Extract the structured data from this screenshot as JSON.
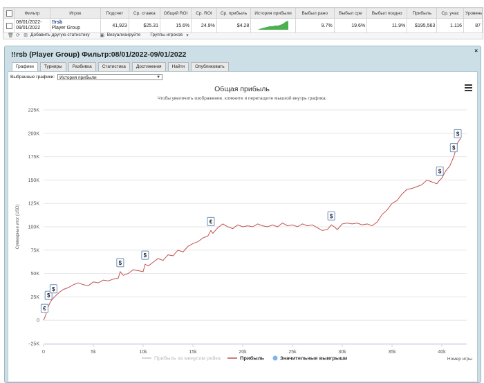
{
  "stats_table": {
    "headers": [
      "Фильтр",
      "Игрок",
      "Подсчет",
      "Ср. ставка",
      "Общий ROI",
      "Ср. ROI",
      "Ср. прибыль",
      "История прибыли",
      "Выбыл рано",
      "Выбыл сре",
      "Выбыл поздно",
      "Прибыль",
      "Ср. учас",
      "Уровень"
    ],
    "row": {
      "filter_line1": "08/01/2022-",
      "filter_line2": "09/01/2022",
      "player_name": "!!rsb",
      "player_group": "Player Group",
      "count": "41,923",
      "avg_stake": "$25.31",
      "total_roi": "15.6%",
      "avg_roi": "24.9%",
      "avg_profit": "$4.28",
      "early": "9.7%",
      "middle": "19.6%",
      "late": "11.9%",
      "profit": "$195,563",
      "avg_entrants": "1.116",
      "level": "87"
    }
  },
  "toolbar": {
    "add_stats": "Добавить другую статистику",
    "visualize": "Визуализируйте",
    "player_groups": "Группы игроков"
  },
  "panel": {
    "title": "!!rsb (Player Group) Фильтр:08/01/2022-09/01/2022",
    "close": "×",
    "tabs": [
      "Графики",
      "Турниры",
      "Разбивка",
      "Статистика",
      "Достижения",
      "Найти",
      "Опубликовать"
    ],
    "selected_charts_label": "Выбранные графики:",
    "selected_chart_value": "История прибыли"
  },
  "colors": {
    "profit_line": "#c0504d",
    "rake_line": "#c7c7c7",
    "win_marker": "#7cb5ec",
    "sparkline": "#4caf50",
    "panel_bg": "#ccdee6"
  },
  "chart_data": {
    "type": "line",
    "title": "Общая прибыль",
    "subtitle": "Чтобы увеличить изображение, кликните и перетащите мышкой внутрь графика.",
    "xlabel": "Номер игры",
    "ylabel": "Суммарные итог (USD)",
    "xlim": [
      0,
      42500
    ],
    "ylim": [
      -25000,
      225000
    ],
    "x_ticks": [
      0,
      5000,
      10000,
      15000,
      20000,
      25000,
      30000,
      35000,
      40000
    ],
    "x_tick_labels": [
      "0",
      "5k",
      "10k",
      "15k",
      "20k",
      "25k",
      "30k",
      "35k",
      "40k"
    ],
    "y_ticks": [
      -25000,
      0,
      25000,
      50000,
      75000,
      100000,
      125000,
      150000,
      175000,
      200000,
      225000
    ],
    "y_tick_labels": [
      "−25K",
      "0",
      "25K",
      "50K",
      "75K",
      "100K",
      "125K",
      "150K",
      "175K",
      "200K",
      "225K"
    ],
    "legend": [
      "Прибыль за минусом рейка",
      "Прибыль",
      "Значительные выигрыши"
    ],
    "legend_position": "bottom",
    "series": [
      {
        "name": "Прибыль",
        "x": [
          0,
          200,
          400,
          700,
          1000,
          1300,
          1600,
          2000,
          2500,
          3000,
          3500,
          4000,
          4500,
          5000,
          5500,
          6000,
          6500,
          7000,
          7500,
          7700,
          8000,
          8500,
          9000,
          9500,
          10000,
          10200,
          10500,
          11000,
          11500,
          12000,
          12500,
          13000,
          13500,
          14000,
          14500,
          15000,
          15500,
          16000,
          16500,
          16800,
          17000,
          17500,
          18000,
          18500,
          19000,
          19500,
          20000,
          20500,
          21000,
          21500,
          22000,
          22500,
          23000,
          23500,
          24000,
          24500,
          25000,
          25500,
          26000,
          26500,
          27000,
          27500,
          28000,
          28500,
          28900,
          29200,
          29500,
          30000,
          30500,
          31000,
          31500,
          32000,
          32500,
          33000,
          33500,
          34000,
          34500,
          35000,
          35500,
          36000,
          36500,
          37000,
          37500,
          38000,
          38500,
          39000,
          39500,
          39800,
          40000,
          40400,
          40800,
          41200,
          41600,
          41900
        ],
        "y": [
          0,
          5000,
          13000,
          20000,
          24000,
          27000,
          30000,
          33000,
          35000,
          38000,
          40000,
          38000,
          37000,
          41000,
          40000,
          43000,
          42000,
          44000,
          45000,
          52000,
          48000,
          50000,
          54000,
          53000,
          52000,
          60000,
          58000,
          62000,
          66000,
          64000,
          70000,
          69000,
          75000,
          73000,
          79000,
          82000,
          84000,
          88000,
          90000,
          96000,
          93000,
          99000,
          103000,
          100000,
          98000,
          102000,
          100000,
          101000,
          100000,
          103000,
          101000,
          100000,
          102000,
          100000,
          104000,
          101000,
          102000,
          100000,
          103000,
          101000,
          102000,
          99000,
          96000,
          97000,
          102000,
          100000,
          97000,
          103000,
          104000,
          103000,
          104000,
          102000,
          103000,
          101000,
          105000,
          113000,
          118000,
          125000,
          128000,
          135000,
          140000,
          141000,
          143000,
          145000,
          150000,
          148000,
          146000,
          150000,
          152000,
          160000,
          165000,
          175000,
          190000,
          195000
        ]
      }
    ],
    "big_wins": [
      {
        "x": 100,
        "y": 3000,
        "label": "€"
      },
      {
        "x": 500,
        "y": 17000,
        "label": "$"
      },
      {
        "x": 1000,
        "y": 24000,
        "label": "$"
      },
      {
        "x": 7700,
        "y": 52000,
        "label": "$"
      },
      {
        "x": 10200,
        "y": 60000,
        "label": "$"
      },
      {
        "x": 16800,
        "y": 96000,
        "label": "€"
      },
      {
        "x": 28900,
        "y": 102000,
        "label": "$"
      },
      {
        "x": 39800,
        "y": 150000,
        "label": "$"
      },
      {
        "x": 41200,
        "y": 175000,
        "label": "$"
      },
      {
        "x": 41600,
        "y": 190000,
        "label": "$"
      }
    ]
  }
}
